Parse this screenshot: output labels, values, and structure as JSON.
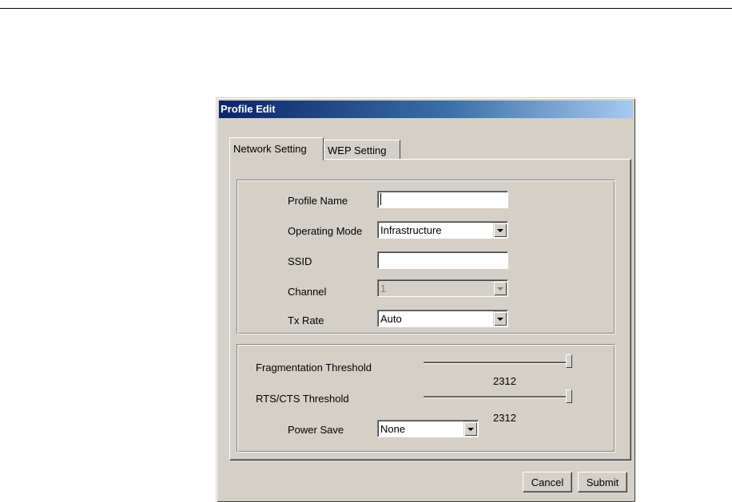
{
  "window": {
    "title": "Profile Edit"
  },
  "tabs": [
    {
      "label": "Network Setting",
      "active": true
    },
    {
      "label": "WEP Setting",
      "active": false
    }
  ],
  "network": {
    "profile_name": {
      "label": "Profile Name",
      "value": ""
    },
    "operating_mode": {
      "label": "Operating Mode",
      "value": "Infrastructure"
    },
    "ssid": {
      "label": "SSID",
      "value": ""
    },
    "channel": {
      "label": "Channel",
      "value": "1",
      "disabled": true
    },
    "tx_rate": {
      "label": "Tx Rate",
      "value": "Auto"
    }
  },
  "advanced": {
    "fragmentation": {
      "label": "Fragmentation Threshold",
      "value": "2312"
    },
    "rts_cts": {
      "label": "RTS/CTS Threshold",
      "value": "2312"
    },
    "power_save": {
      "label": "Power Save",
      "value": "None"
    }
  },
  "buttons": {
    "cancel": "Cancel",
    "submit": "Submit"
  },
  "colors": {
    "title_start": "#0a246a",
    "title_end": "#a6caf0",
    "face": "#d4d0c8"
  }
}
